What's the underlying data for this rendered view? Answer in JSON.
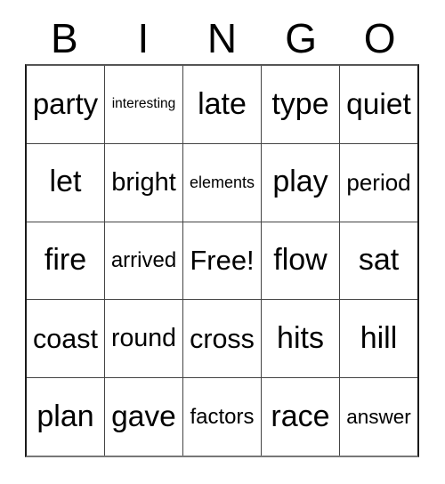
{
  "card": {
    "header": {
      "letters": [
        "B",
        "I",
        "N",
        "G",
        "O"
      ]
    },
    "grid": {
      "columns": 5,
      "rows": 5,
      "free_space": "Free!",
      "cells": [
        [
          "party",
          "interesting",
          "late",
          "type",
          "quiet"
        ],
        [
          "let",
          "bright",
          "elements",
          "play",
          "period"
        ],
        [
          "fire",
          "arrived",
          "Free!",
          "flow",
          "sat"
        ],
        [
          "coast",
          "round",
          "cross",
          "hits",
          "hill"
        ],
        [
          "plan",
          "gave",
          "factors",
          "race",
          "answer"
        ]
      ]
    },
    "colors": {
      "background": "#ffffff",
      "text": "#000000",
      "grid_line": "#444444",
      "grid_border": "#1a1a1a"
    }
  }
}
